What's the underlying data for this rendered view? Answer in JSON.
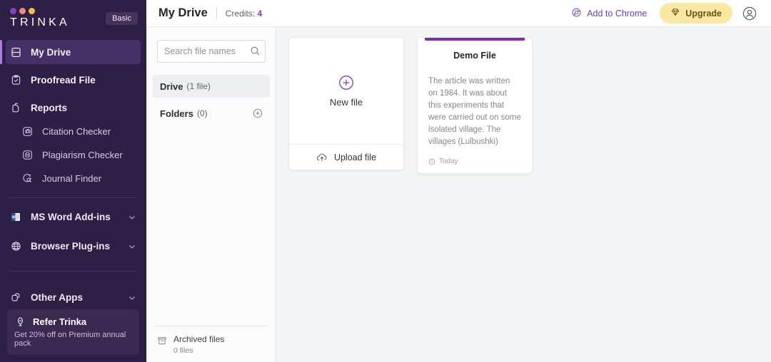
{
  "sidebar": {
    "brand": "TRINKA",
    "plan_badge": "Basic",
    "dot_colors": [
      "#8a3fc0",
      "#f08a7c",
      "#f0c04a"
    ],
    "items": [
      {
        "label": "My Drive",
        "icon": "drive-icon",
        "active": true
      },
      {
        "label": "Proofread File",
        "icon": "proofread-icon",
        "active": false
      },
      {
        "label": "Reports",
        "icon": "reports-icon",
        "active": false
      }
    ],
    "report_children": [
      {
        "label": "Citation Checker",
        "icon": "citation-icon"
      },
      {
        "label": "Plagiarism Checker",
        "icon": "plagiarism-icon"
      },
      {
        "label": "Journal Finder",
        "icon": "journal-finder-icon"
      }
    ],
    "groups": [
      {
        "label": "MS Word Add-ins",
        "icon": "ms-word-icon"
      },
      {
        "label": "Browser Plug-ins",
        "icon": "globe-icon"
      },
      {
        "label": "Other Apps",
        "icon": "apps-icon"
      }
    ],
    "refer": {
      "title": "Refer Trinka",
      "subtitle": "Get 20% off on Premium annual pack",
      "icon": "refer-megaphone-icon"
    }
  },
  "topbar": {
    "title": "My Drive",
    "credits_label": "Credits:",
    "credits_value": "4",
    "credits_color": "#7b3fb5",
    "add_to_chrome": "Add to Chrome",
    "add_to_chrome_icon": "chrome-icon",
    "upgrade": "Upgrade",
    "upgrade_icon": "diamond-icon",
    "upgrade_bg": "#fae8a4",
    "account_icon": "user-avatar-icon"
  },
  "filepanel": {
    "search_placeholder": "Search file names",
    "search_value": "",
    "search_icon": "search-icon",
    "drive": {
      "name": "Drive",
      "count": "(1  file)"
    },
    "folders": {
      "name": "Folders",
      "count": "(0)",
      "add_icon": "plus-icon"
    },
    "archived": {
      "title": "Archived files",
      "subtitle": "0 files",
      "icon": "archive-box-icon"
    }
  },
  "cards": {
    "new_file": {
      "label": "New file",
      "plus_icon": "plus-circle-icon",
      "upload_label": "Upload file",
      "upload_icon": "cloud-upload-icon"
    },
    "demo_file": {
      "title": "Demo File",
      "accent_color": "#7a2fb0",
      "excerpt": "The article was written on 1984. It was about this experiments that were carried out on some isolated village. The villages (Lulbushki)",
      "timestamp": "Today",
      "timestamp_icon": "clock-icon"
    }
  }
}
